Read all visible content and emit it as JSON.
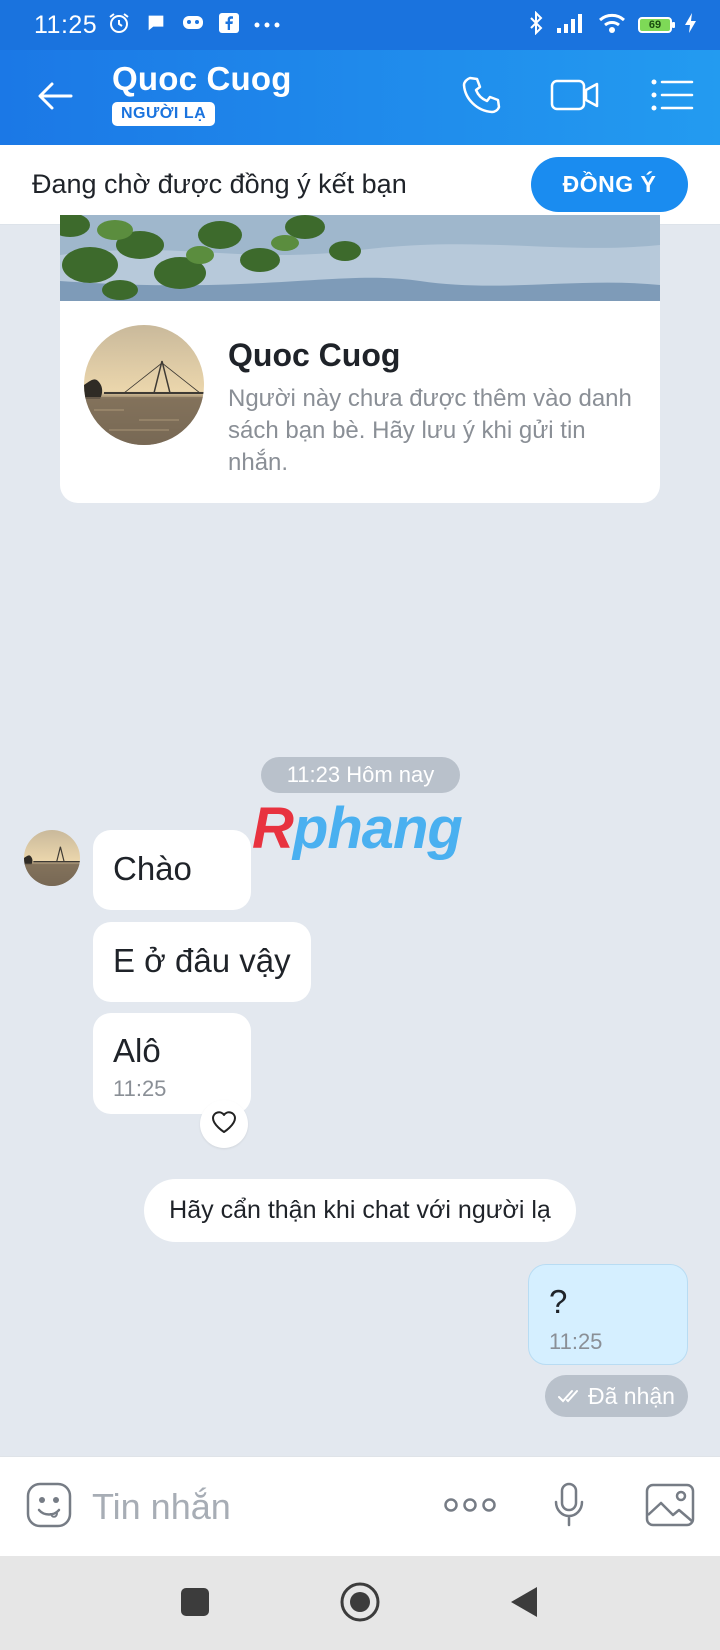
{
  "status_bar": {
    "time": "11:25",
    "battery": "69",
    "icons": [
      "alarm-icon",
      "chat-bubble-icon",
      "gamepad-icon",
      "facebook-icon",
      "more-dots-icon",
      "bluetooth-icon",
      "signal-icon",
      "wifi-icon",
      "battery-icon",
      "charging-icon"
    ]
  },
  "header": {
    "contact_name": "Quoc Cuog",
    "badge": "NGƯỜI LẠ",
    "icons": [
      "back-arrow-icon",
      "phone-icon",
      "video-call-icon",
      "menu-list-icon"
    ]
  },
  "friend_request": {
    "text": "Đang chờ được đồng ý kết bạn",
    "accept_label": "ĐỒNG Ý",
    "accent": "#1a8cf0"
  },
  "profile_card": {
    "name": "Quoc Cuog",
    "description": "Người này chưa được thêm vào danh sách bạn bè. Hãy lưu ý khi gửi tin nhắn."
  },
  "chat": {
    "time_divider": "11:23 Hôm nay",
    "watermark_r": "R",
    "watermark_rest": "phang",
    "incoming": [
      {
        "text": "Chào"
      },
      {
        "text": "E ở đâu vậy"
      },
      {
        "text": "Alô",
        "time": "11:25"
      }
    ],
    "warning": "Hãy cẩn thận khi chat với người lạ",
    "outgoing": {
      "text": "?",
      "time": "11:25"
    },
    "delivery_status": "Đã nhận"
  },
  "input_bar": {
    "placeholder": "Tin nhắn",
    "icons": [
      "emoji-icon",
      "more-icon",
      "microphone-icon",
      "image-icon"
    ]
  },
  "nav_bar": {
    "icons": [
      "recents-icon",
      "home-icon",
      "back-icon"
    ]
  },
  "colors": {
    "header_blue": "#1b78e6",
    "chat_background": "#e3e8ef",
    "outgoing_bubble": "#d5efff"
  }
}
